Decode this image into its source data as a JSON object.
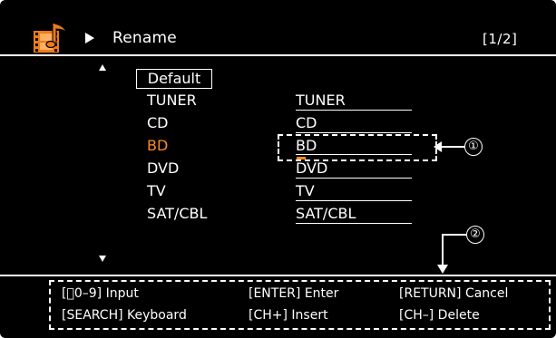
{
  "header": {
    "title": "Rename",
    "page_indicator": "[1/2]",
    "icon": "film-music-icon",
    "arrow_icon": "play-arrow-icon"
  },
  "default_button": {
    "label": "Default"
  },
  "sources": [
    {
      "label": "TUNER",
      "name": "TUNER"
    },
    {
      "label": "CD",
      "name": "CD"
    },
    {
      "label": "BD",
      "name": "BD"
    },
    {
      "label": "DVD",
      "name": "DVD"
    },
    {
      "label": "TV",
      "name": "TV"
    },
    {
      "label": "SAT/CBL",
      "name": "SAT/CBL"
    }
  ],
  "selected_source": "BD",
  "callouts": {
    "one": "①",
    "two": "②"
  },
  "help": {
    "input": "[⃝0–9] Input",
    "enter": "[ENTER] Enter",
    "return": "[RETURN] Cancel",
    "search": "[SEARCH] Keyboard",
    "insert": "[CH+]  Insert",
    "delete": "[CH–]  Delete"
  },
  "colors": {
    "background": "#000000",
    "text": "#ffffff",
    "highlight": "#ff8a1f",
    "icon_orange": "#ee7a1a"
  }
}
